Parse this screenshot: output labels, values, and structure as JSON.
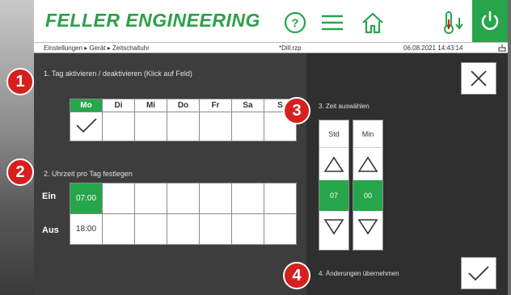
{
  "header": {
    "brand": "FELLER ENGINEERING"
  },
  "statusbar": {
    "breadcrumb": "Einstellungen ▸ Gerät ▸ Zeitschaltuhr",
    "project": "*Dill.rzp",
    "datetime": "06.08.2021 14:43:14"
  },
  "section1": {
    "badge": "1",
    "title": "1. Tag aktivieren / deaktivieren (Klick auf Feld)",
    "days": [
      "Mo",
      "Di",
      "Mi",
      "Do",
      "Fr",
      "Sa",
      "S"
    ],
    "active_day_index": 0
  },
  "section2": {
    "badge": "2",
    "title": "2. Uhrzeit pro Tag festlegen",
    "on_label": "Ein",
    "off_label": "Aus",
    "on_time": "07:00",
    "off_time": "18:00"
  },
  "section3": {
    "badge": "3",
    "title": "3. Zeit auswählen",
    "hour_label": "Std",
    "minute_label": "Min",
    "hour_value": "07",
    "minute_value": "00"
  },
  "section4": {
    "badge": "4",
    "title": "4. Änderungen übernehmen"
  },
  "colors": {
    "brand_green": "#2f9e4a",
    "accent_green": "#27a54b",
    "badge_red": "#d6201e"
  },
  "icons": [
    "help-icon",
    "menu-icon",
    "home-icon",
    "thermometer-icon",
    "power-icon",
    "close-icon",
    "check-icon",
    "arrow-up-icon",
    "arrow-down-icon",
    "network-icon"
  ]
}
